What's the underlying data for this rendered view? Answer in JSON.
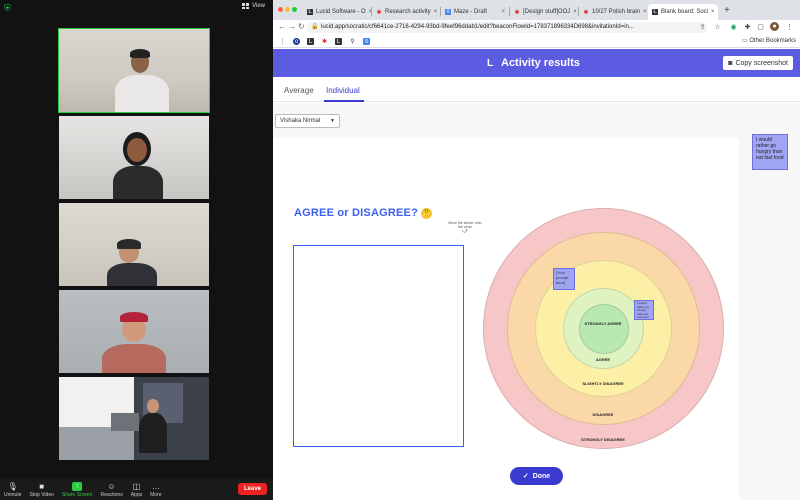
{
  "zoom": {
    "view_label": "View",
    "toolbar": {
      "unmute": "Unmute",
      "stop_video": "Stop Video",
      "share_screen": "Share Screen",
      "reactions": "Reactions",
      "apps": "Apps",
      "more": "More",
      "leave": "Leave"
    }
  },
  "browser": {
    "tabs": [
      {
        "label": "Lucid Software - O",
        "icon": "lucid-icon"
      },
      {
        "label": "Research activity",
        "icon": "asterisk-icon"
      },
      {
        "label": "Maze - Draft",
        "icon": "docs-icon"
      },
      {
        "label": "[Design stuff]OOJ",
        "icon": "asterisk-icon"
      },
      {
        "label": "10/27 Polish brain",
        "icon": "asterisk-icon"
      },
      {
        "label": "Blank board: Soci",
        "icon": "lucid-icon"
      }
    ],
    "url": "lucid.app/socratic/cf6641ce-2716-4294-93bd-9feef96ddab1/edit?beaconFlowId=178371896334D698&invitationId=in...",
    "other_bookmarks": "Other Bookmarks"
  },
  "page": {
    "header_title": "Activity results",
    "copy_button": "Copy screenshot",
    "tabs": [
      "Average",
      "Individual"
    ],
    "user_select": "Vishaka Nirmal",
    "sidebar_note": "I would rather go hungry than eat fast food",
    "board_title": "AGREE or DISAGREE?",
    "hint": "Move the sticker onto the circle",
    "rings": [
      "STRONGLY AGREE",
      "AGREE",
      "SLIGHTLY DISAGREE",
      "DISAGREE",
      "STRONGLY DISAGREE"
    ],
    "sticky_1": "[Your prompt here]",
    "sticky_2": "I would rather go hungry than eat fast food",
    "done_button": "Done"
  },
  "colors": {
    "accent": "#5b5ce2",
    "primary_button": "#3b3ccf",
    "title_blue": "#3b5ff0",
    "ring_outer": "#f7c6c6",
    "ring_2": "#fbd8a8",
    "ring_3": "#fcefa6",
    "ring_4": "#dff3c0",
    "ring_center": "#b9e8b2",
    "zoom_active": "#2ecc40",
    "leave": "#e22222"
  }
}
